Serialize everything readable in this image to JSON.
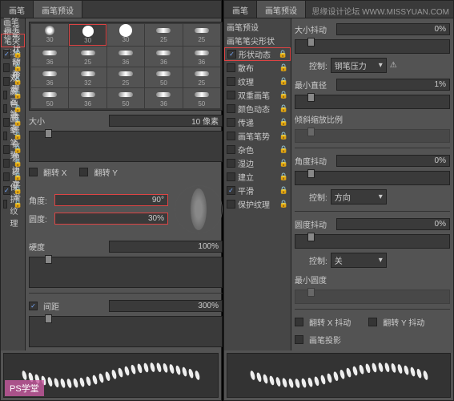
{
  "tabs": {
    "brush": "画笔",
    "preset": "画笔预设"
  },
  "sidebar": [
    {
      "label": "画笔预设",
      "chk": "",
      "lock": ""
    },
    {
      "label": "画笔笔尖形状",
      "chk": "",
      "lock": "",
      "hl": true
    },
    {
      "label": "形状动态",
      "chk": "✓",
      "lock": "🔒"
    },
    {
      "label": "散布",
      "chk": "",
      "lock": "🔒"
    },
    {
      "label": "纹理",
      "chk": "",
      "lock": "🔒"
    },
    {
      "label": "双重画笔",
      "chk": "",
      "lock": "🔒"
    },
    {
      "label": "颜色动态",
      "chk": "",
      "lock": "🔒"
    },
    {
      "label": "传递",
      "chk": "",
      "lock": "🔒"
    },
    {
      "label": "画笔笔势",
      "chk": "",
      "lock": "🔒"
    },
    {
      "label": "杂色",
      "chk": "",
      "lock": "🔒"
    },
    {
      "label": "湿边",
      "chk": "",
      "lock": "🔒"
    },
    {
      "label": "建立",
      "chk": "",
      "lock": "🔒"
    },
    {
      "label": "平滑",
      "chk": "✓",
      "lock": "🔒"
    },
    {
      "label": "保护纹理",
      "chk": "",
      "lock": "🔒"
    }
  ],
  "thumbs": [
    30,
    30,
    30,
    25,
    25,
    36,
    25,
    36,
    36,
    36,
    36,
    32,
    25,
    50,
    25,
    50,
    36,
    50,
    36,
    50
  ],
  "size": {
    "label": "大小",
    "value": "10 像素"
  },
  "flip": {
    "x": "翻转 X",
    "y": "翻转 Y"
  },
  "angle": {
    "label": "角度:",
    "value": "90°"
  },
  "round": {
    "label": "圆度:",
    "value": "30%"
  },
  "hard": {
    "label": "硬度",
    "value": "100%"
  },
  "spacing": {
    "label": "间距",
    "value": "300%",
    "chk": "✓"
  },
  "right": {
    "sizeJitter": {
      "label": "大小抖动",
      "value": "0%"
    },
    "control1": {
      "label": "控制:",
      "value": "钢笔压力"
    },
    "minDia": {
      "label": "最小直径",
      "value": "1%"
    },
    "tiltScale": "倾斜缩放比例",
    "angleJitter": {
      "label": "角度抖动",
      "value": "0%"
    },
    "control2": {
      "label": "控制:",
      "value": "方向"
    },
    "roundJitter": {
      "label": "圆度抖动",
      "value": "0%"
    },
    "control3": {
      "label": "控制:",
      "value": "关"
    },
    "minRound": "最小圆度",
    "flipX": "翻转 X 抖动",
    "flipY": "翻转 Y 抖动",
    "proj": "画笔投影"
  },
  "wm": "PS学堂",
  "wm2": "思缘设计论坛   WWW.MISSYUAN.COM"
}
